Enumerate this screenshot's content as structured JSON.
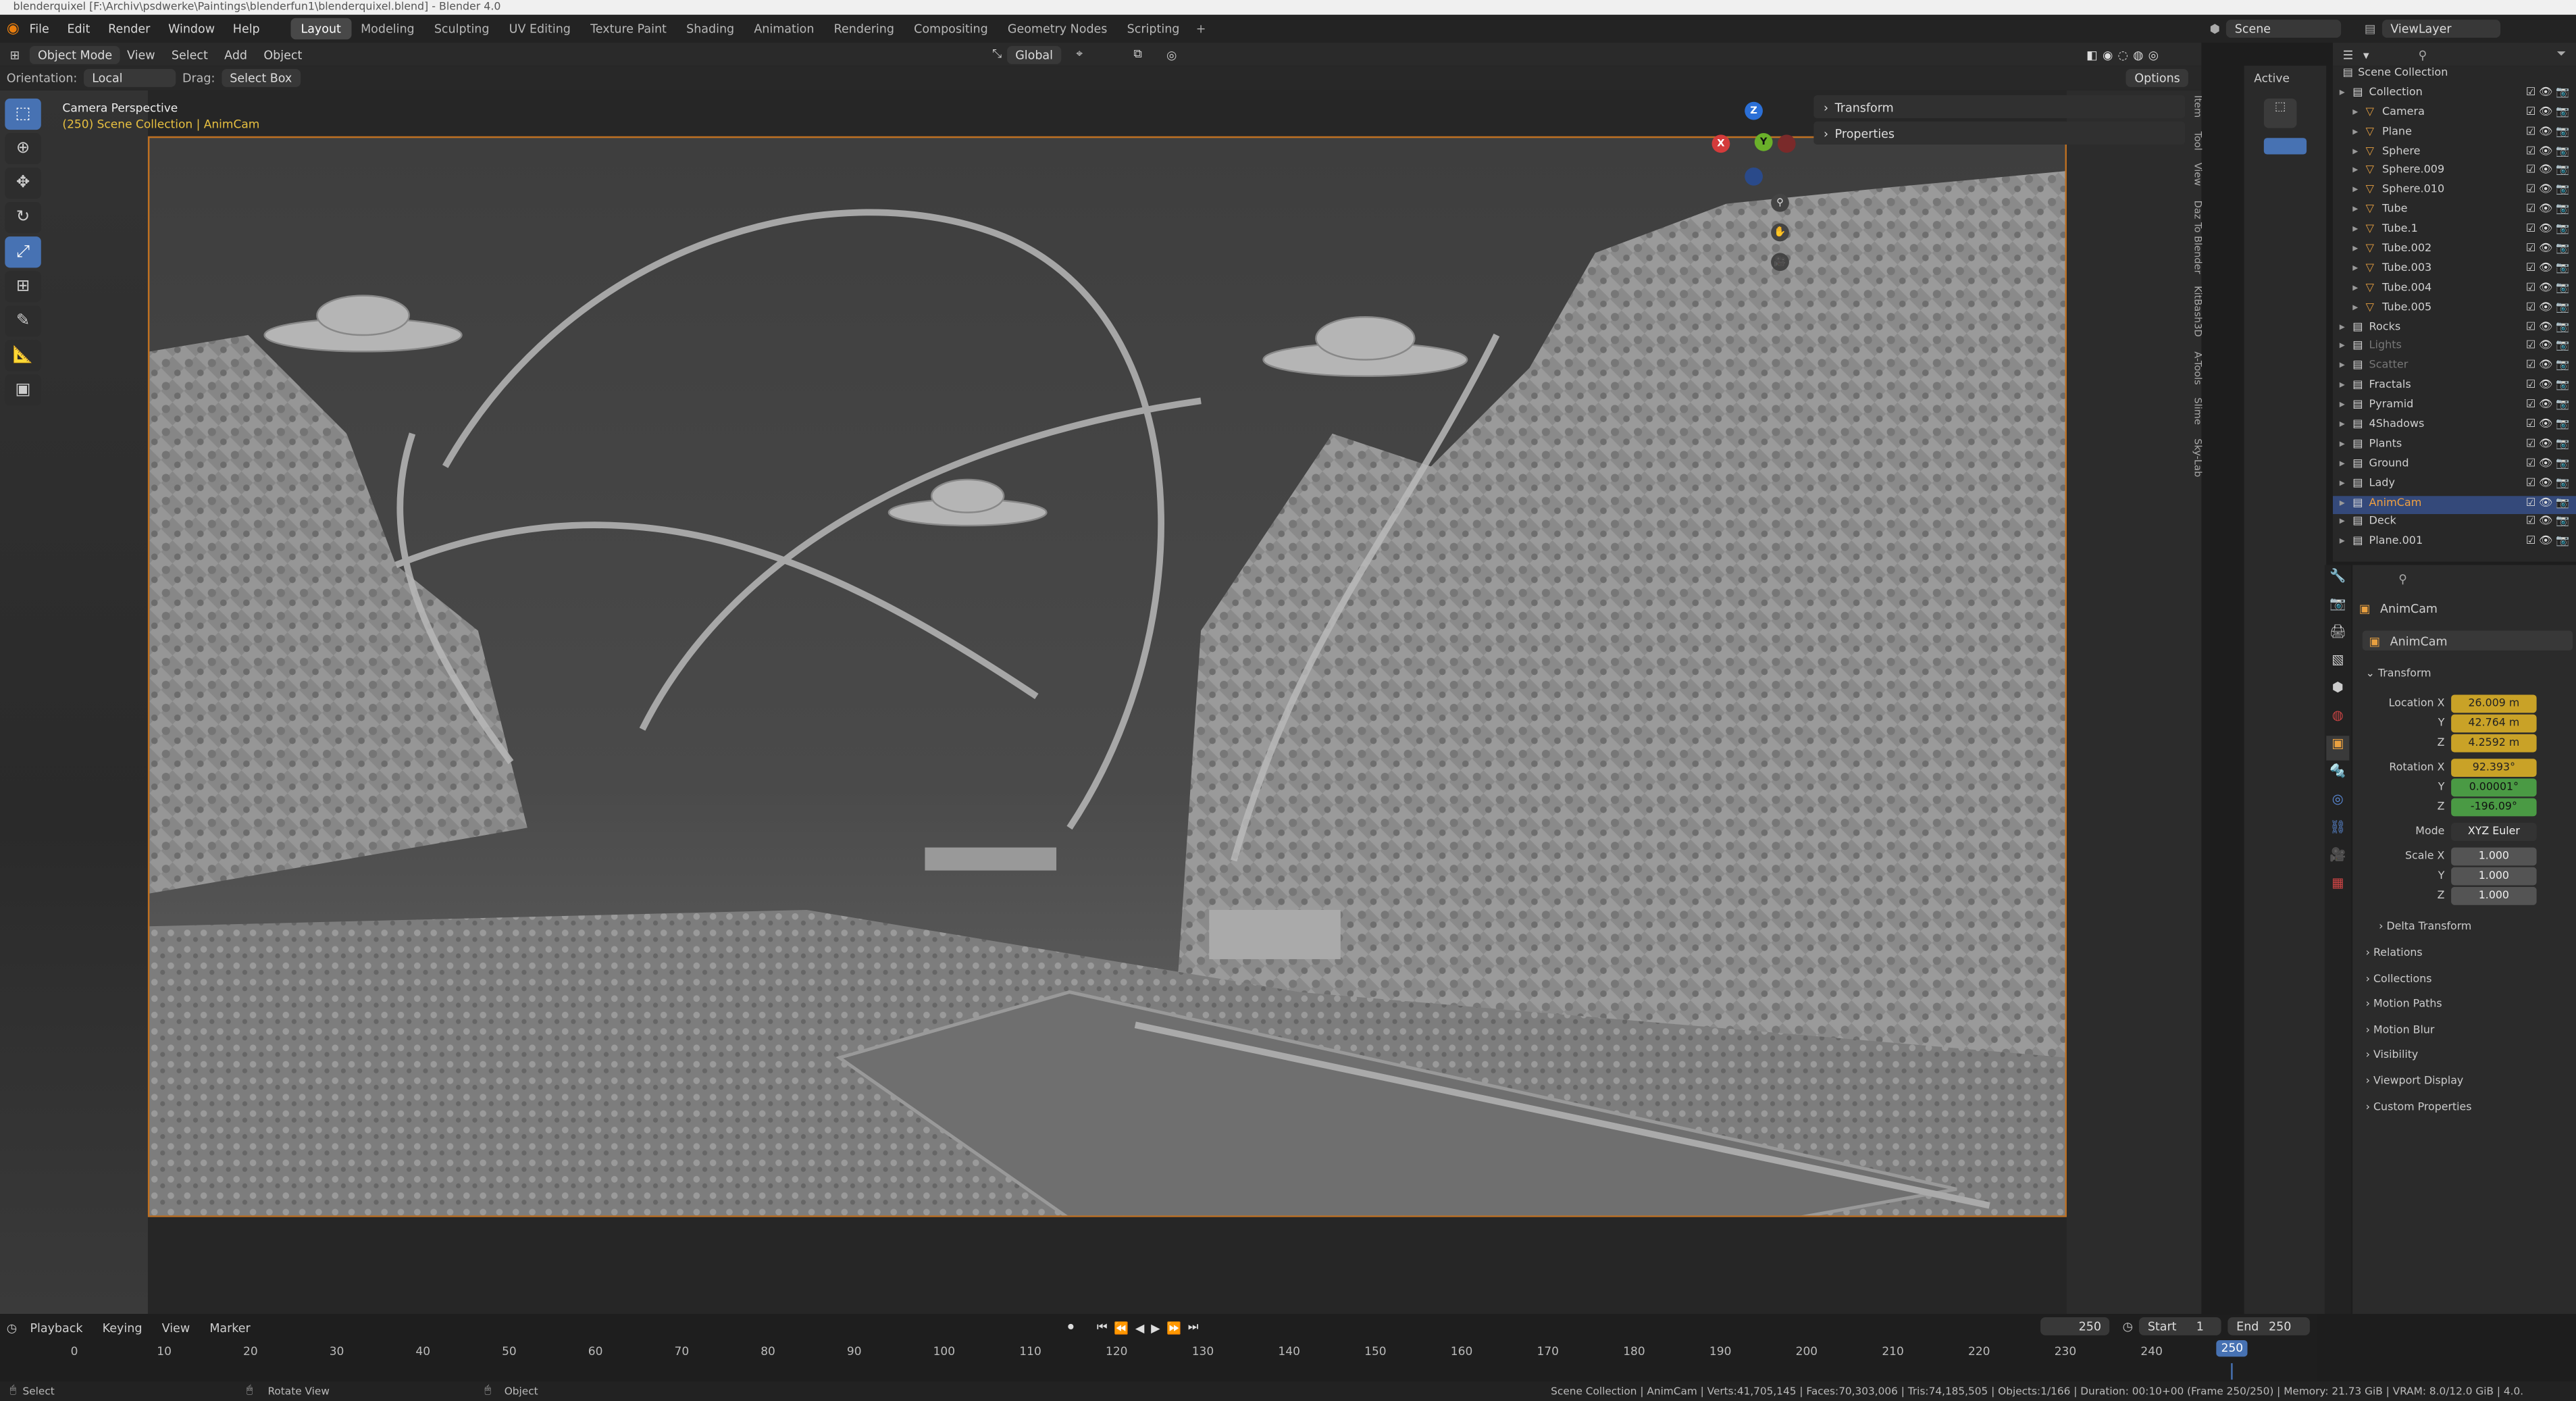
{
  "window_title": "blenderquixel [F:\\Archiv\\psdwerke\\Paintings\\blenderfun1\\blenderquixel.blend] - Blender 4.0",
  "menu": [
    "File",
    "Edit",
    "Render",
    "Window",
    "Help"
  ],
  "workspaces": [
    "Layout",
    "Modeling",
    "Sculpting",
    "UV Editing",
    "Texture Paint",
    "Shading",
    "Animation",
    "Rendering",
    "Compositing",
    "Geometry Nodes",
    "Scripting"
  ],
  "active_workspace": "Layout",
  "scene_label": "Scene",
  "viewlayer_label": "ViewLayer",
  "header": {
    "mode": "Object Mode",
    "menus": [
      "View",
      "Select",
      "Add",
      "Object"
    ],
    "transform": "Global"
  },
  "header2": {
    "orientation_label": "Orientation:",
    "orientation": "Local",
    "drag_label": "Drag:",
    "drag": "Select Box",
    "options": "Options"
  },
  "overlay": {
    "line1": "Camera Perspective",
    "line2": "(250) Scene Collection | AnimCam"
  },
  "npanel": {
    "transform": "Transform",
    "properties": "Properties"
  },
  "vtabs": [
    "Item",
    "Tool",
    "View",
    "Daz To Blender",
    "KitBash3D",
    "A-Tools",
    "Slime",
    "Sky-Lab"
  ],
  "active_panel": {
    "label": "Active"
  },
  "outliner": {
    "root": "Scene Collection",
    "items": [
      {
        "name": "Collection",
        "level": 0,
        "type": "coll"
      },
      {
        "name": "Camera",
        "level": 1
      },
      {
        "name": "Plane",
        "level": 1
      },
      {
        "name": "Sphere",
        "level": 1
      },
      {
        "name": "Sphere.009",
        "level": 1
      },
      {
        "name": "Sphere.010",
        "level": 1
      },
      {
        "name": "Tube",
        "level": 1
      },
      {
        "name": "Tube.1",
        "level": 1
      },
      {
        "name": "Tube.002",
        "level": 1
      },
      {
        "name": "Tube.003",
        "level": 1
      },
      {
        "name": "Tube.004",
        "level": 1
      },
      {
        "name": "Tube.005",
        "level": 1
      },
      {
        "name": "Rocks",
        "level": 0,
        "type": "coll"
      },
      {
        "name": "Lights",
        "level": 0,
        "type": "coll",
        "dim": true
      },
      {
        "name": "Scatter",
        "level": 0,
        "type": "coll",
        "dim": true
      },
      {
        "name": "Fractals",
        "level": 0,
        "type": "coll"
      },
      {
        "name": "Pyramid",
        "level": 0,
        "type": "coll"
      },
      {
        "name": "4Shadows",
        "level": 0,
        "type": "coll"
      },
      {
        "name": "Plants",
        "level": 0,
        "type": "coll"
      },
      {
        "name": "Ground",
        "level": 0,
        "type": "coll"
      },
      {
        "name": "Lady",
        "level": 0,
        "type": "coll"
      },
      {
        "name": "AnimCam",
        "level": 0,
        "type": "coll",
        "selected": true
      },
      {
        "name": "Deck",
        "level": 0,
        "type": "coll"
      },
      {
        "name": "Plane.001",
        "level": 0,
        "type": "coll"
      }
    ]
  },
  "properties": {
    "object": "AnimCam",
    "data_name": "AnimCam",
    "transform": "Transform",
    "location": {
      "label": "Location X",
      "x": "26.009 m",
      "y": "42.764 m",
      "z": "4.2592 m"
    },
    "rotation": {
      "label": "Rotation X",
      "x": "92.393°",
      "y": "0.00001°",
      "z": "-196.09°"
    },
    "mode_label": "Mode",
    "mode": "XYZ Euler",
    "scale": {
      "label": "Scale X",
      "x": "1.000",
      "y": "1.000",
      "z": "1.000"
    },
    "axis_y": "Y",
    "axis_z": "Z",
    "sections": [
      "Delta Transform",
      "Relations",
      "Collections",
      "Motion Paths",
      "Motion Blur",
      "Visibility",
      "Viewport Display",
      "Custom Properties"
    ]
  },
  "timeline": {
    "menus": [
      "Playback",
      "Keying",
      "View",
      "Marker"
    ],
    "current": "250",
    "start_label": "Start",
    "start": "1",
    "end_label": "End",
    "end": "250",
    "ticks": [
      "0",
      "10",
      "20",
      "30",
      "40",
      "50",
      "60",
      "70",
      "80",
      "90",
      "100",
      "110",
      "120",
      "130",
      "140",
      "150",
      "160",
      "170",
      "180",
      "190",
      "200",
      "210",
      "220",
      "230",
      "240"
    ],
    "cursor": "250"
  },
  "status": {
    "left": "Select",
    "mid": "Rotate View",
    "right": "Object",
    "stats": "Scene Collection | AnimCam | Verts:41,705,145 | Faces:70,303,006 | Tris:74,185,505 | Objects:1/166 | Duration: 00:10+00 (Frame 250/250) | Memory: 21.73 GiB | VRAM: 8.0/12.0 GiB | 4.0."
  }
}
